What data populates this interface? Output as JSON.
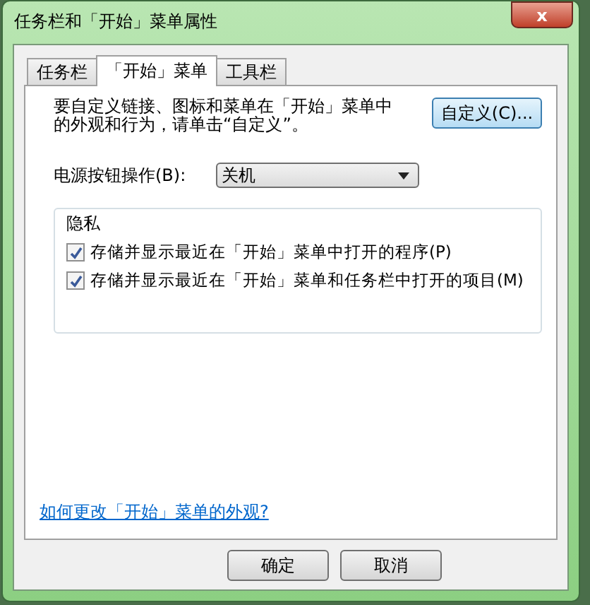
{
  "window": {
    "title": "任务栏和「开始」菜单属性",
    "close": "x"
  },
  "tabs": [
    {
      "label": "任务栏",
      "selected": false
    },
    {
      "label": "「开始」菜单",
      "selected": true
    },
    {
      "label": "工具栏",
      "selected": false
    }
  ],
  "intro": "要自定义链接、图标和菜单在「开始」菜单中的外观和行为，请单击“自定义”。",
  "customize_button": "自定义(C)...",
  "power": {
    "label": "电源按钮操作(B):",
    "value": "关机"
  },
  "privacy": {
    "title": "隐私",
    "options": [
      {
        "label": "存储并显示最近在「开始」菜单中打开的程序(P)",
        "checked": true
      },
      {
        "label": "存储并显示最近在「开始」菜单和任务栏中打开的项目(M)",
        "checked": true
      }
    ]
  },
  "help_link": "如何更改「开始」菜单的外观?",
  "buttons": [
    "确定",
    "取消"
  ]
}
